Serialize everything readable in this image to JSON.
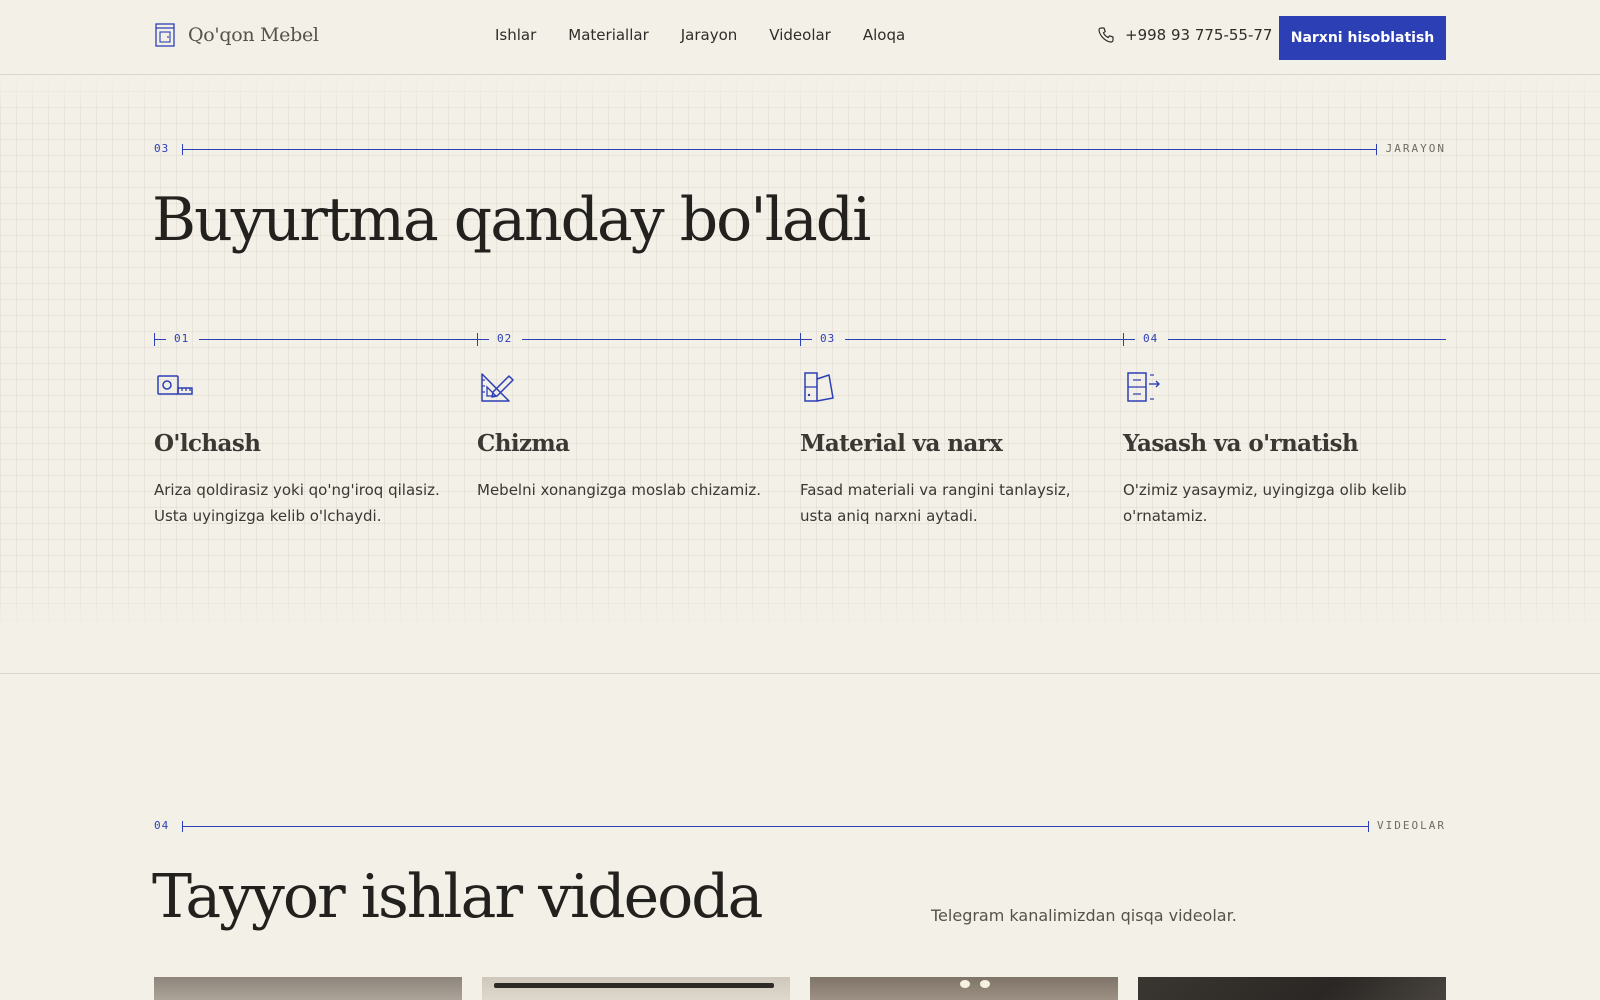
{
  "header": {
    "logo_text": "Qo'qon Mebel",
    "nav": [
      "Ishlar",
      "Materiallar",
      "Jarayon",
      "Videolar",
      "Aloqa"
    ],
    "phone": "+998 93 775-55-77",
    "cta_label": "Narxni hisoblatish"
  },
  "process": {
    "section_number": "03",
    "section_label": "JARAYON",
    "title": "Buyurtma qanday bo'ladi",
    "steps": [
      {
        "number": "01",
        "icon": "tape-measure-icon",
        "title": "O'lchash",
        "description": "Ariza qoldirasiz yoki qo'ng'iroq qilasiz. Usta uyingizga kelib o'lchaydi."
      },
      {
        "number": "02",
        "icon": "drafting-triangle-icon",
        "title": "Chizma",
        "description": "Mebelni xonangizga moslab chizamiz."
      },
      {
        "number": "03",
        "icon": "material-swatch-icon",
        "title": "Material va narx",
        "description": "Fasad materiali va rangini tanlaysiz, usta aniq narxni aytadi."
      },
      {
        "number": "04",
        "icon": "install-cabinet-icon",
        "title": "Yasash va o'rnatish",
        "description": "O'zimiz yasaymiz, uyingizga olib kelib o'rnatamiz."
      }
    ]
  },
  "videos": {
    "section_number": "04",
    "section_label": "VIDEOLAR",
    "title": "Tayyor ishlar videoda",
    "subtitle": "Telegram kanalimizdan qisqa videolar."
  },
  "colors": {
    "accent": "#2c3fb5",
    "background": "#f3f0e8",
    "text": "#2a2824"
  }
}
